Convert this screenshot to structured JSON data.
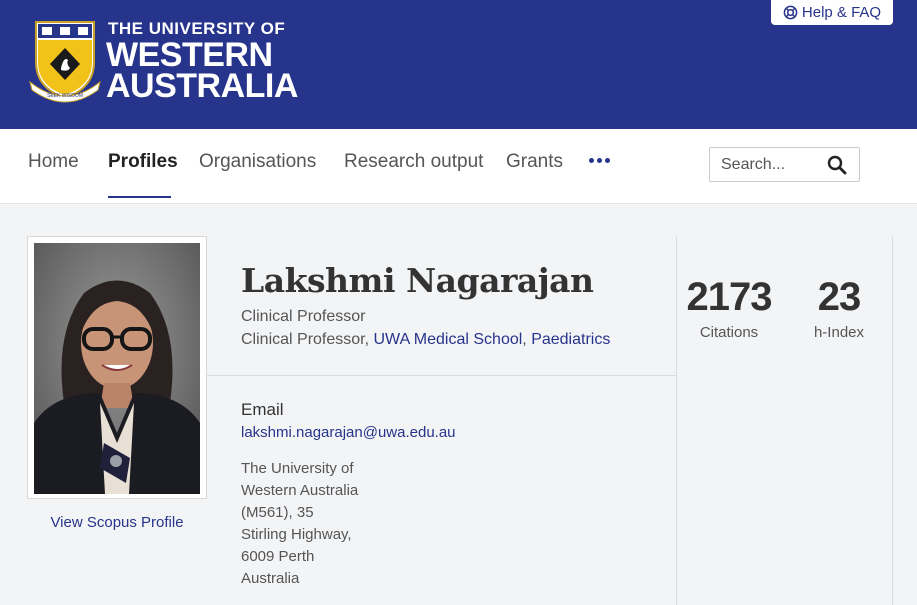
{
  "header": {
    "logo_line1": "THE UNIVERSITY OF",
    "logo_line2": "WESTERN",
    "logo_line3": "AUSTRALIA",
    "crest_motto": "SEEK WISDOM",
    "help_label": "Help & FAQ",
    "brand_color": "#27348b"
  },
  "nav": {
    "items": [
      {
        "label": "Home",
        "active": false
      },
      {
        "label": "Profiles",
        "active": true
      },
      {
        "label": "Organisations",
        "active": false
      },
      {
        "label": "Research output",
        "active": false
      },
      {
        "label": "Grants",
        "active": false
      }
    ],
    "more_icon": "more-horizontal-icon",
    "search_placeholder": "Search...",
    "search_icon": "search-icon"
  },
  "profile": {
    "name": "Lakshmi Nagarajan",
    "position1": "Clinical Professor",
    "position2_prefix": "Clinical Professor, ",
    "position2_org1": "UWA Medical School",
    "position2_sep": ", ",
    "position2_org2": "Paediatrics",
    "scopus_link": "View Scopus Profile",
    "email_label": "Email",
    "email": "lakshmi.nagarajan@uwa.edu.au",
    "address_lines": [
      "The University of",
      "Western Australia",
      "(M561), 35",
      "Stirling Highway,",
      "6009 Perth",
      "Australia"
    ]
  },
  "metrics": {
    "citations_value": "2173",
    "citations_label": "Citations",
    "hindex_value": "23",
    "hindex_label": "h-Index"
  }
}
